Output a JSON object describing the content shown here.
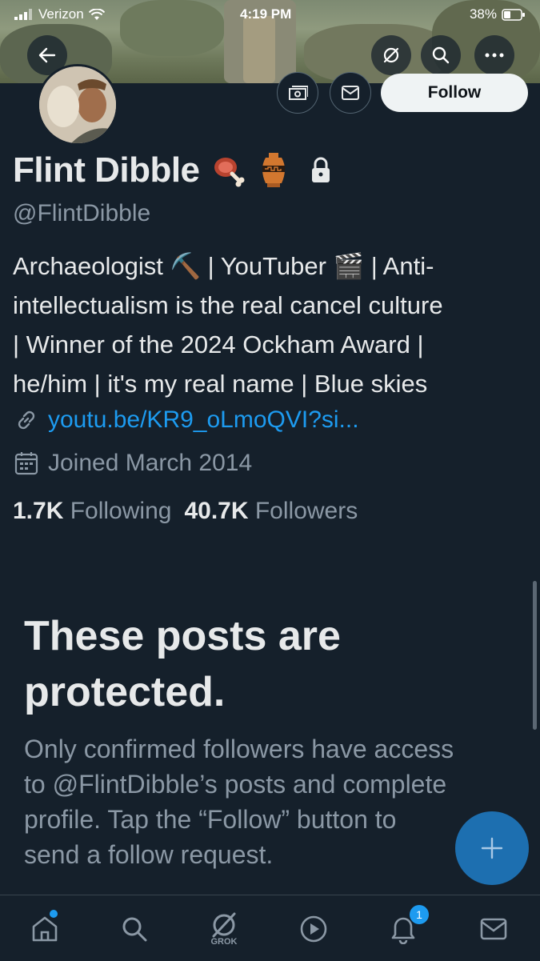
{
  "status_bar": {
    "carrier": "Verizon",
    "time": "4:19 PM",
    "battery": "38%"
  },
  "header": {
    "follow_label": "Follow"
  },
  "profile": {
    "name": "Flint Dibble",
    "handle": "@FlintDibble",
    "bio_lines": [
      "Archaeologist ⛏️ | YouTuber 🎬 | Anti-",
      "intellectualism is the real cancel culture",
      "| Winner of the 2024 Ockham Award |",
      "he/him | it's my real name | Blue skies"
    ],
    "link": "youtu.be/KR9_oLmoQVI?si...",
    "joined": "Joined March 2014",
    "following_count": "1.7K",
    "following_label": "Following",
    "followers_count": "40.7K",
    "followers_label": "Followers"
  },
  "protected": {
    "title_lines": [
      "These posts are",
      "protected."
    ],
    "body_lines": [
      "Only confirmed followers have access",
      "to @FlintDibble’s posts and complete",
      "profile. Tap the “Follow” button to",
      "send a follow request."
    ]
  },
  "nav": {
    "grok_label": "GROK",
    "notifications_badge": "1"
  },
  "colors": {
    "background": "#15202b",
    "accent": "#1d9bf0",
    "secondary_text": "#8b98a5"
  }
}
